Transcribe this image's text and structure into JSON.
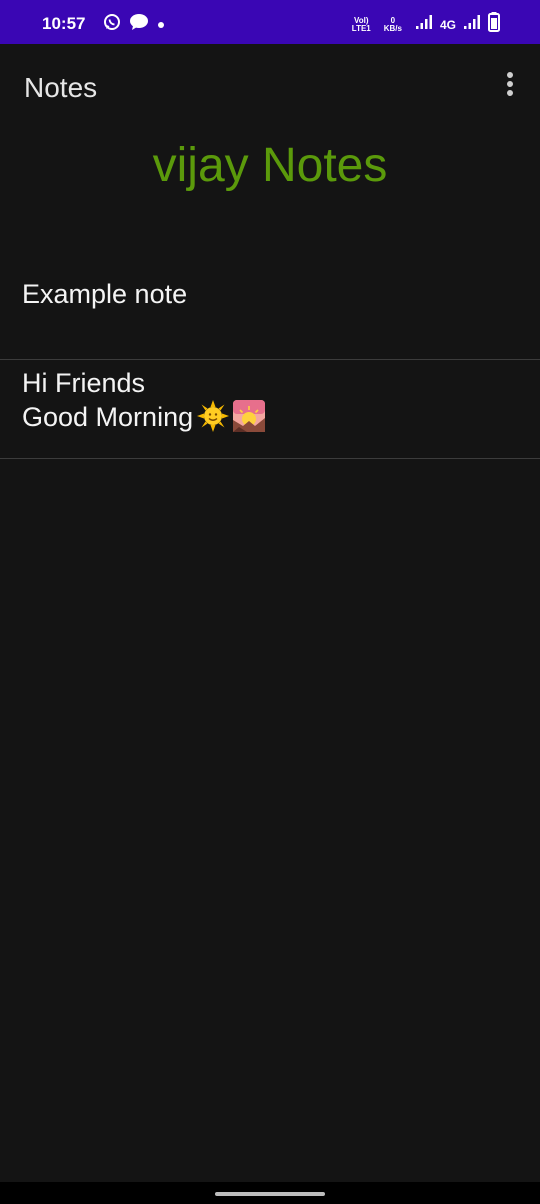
{
  "status_bar": {
    "time": "10:57",
    "volte_top": "Vol)",
    "volte_bottom": "LTE1",
    "speed_value": "0",
    "speed_unit": "KB/s",
    "network": "4G",
    "icons": [
      "whatsapp-icon",
      "chat-bubble-icon",
      "notification-dot-icon",
      "signal-icon",
      "signal-icon",
      "battery-icon"
    ],
    "background": "#3a06b4"
  },
  "toolbar": {
    "title": "Notes",
    "menu_icon": "more-vert-icon"
  },
  "heading": {
    "text": "vijay Notes",
    "color": "#5b9a0b"
  },
  "notes": [
    {
      "text": "Example note"
    },
    {
      "text": "Hi Friends\nGood Morning",
      "emojis": [
        "sun-with-face",
        "sunrise-over-mountains"
      ]
    }
  ],
  "theme": {
    "background": "#141414",
    "divider": "#3c3c3c"
  }
}
